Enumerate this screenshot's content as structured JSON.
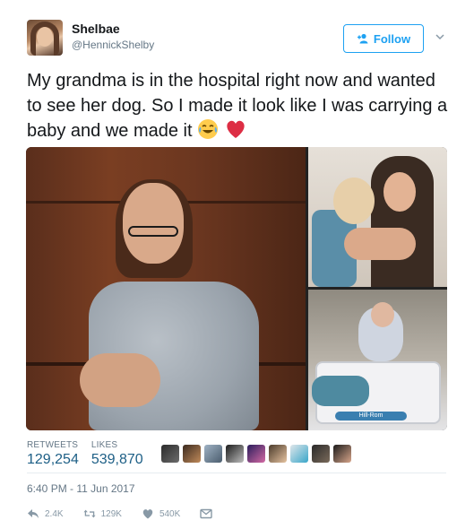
{
  "user": {
    "name": "Shelbae",
    "handle": "@HennickShelby"
  },
  "follow": {
    "label": "Follow"
  },
  "tweet": {
    "text": "My grandma is in the hospital right now and wanted to see her dog. So I made it look like I was carrying a baby and we made it",
    "emojis": [
      "face-with-tears-of-joy",
      "red-heart"
    ]
  },
  "stats": {
    "retweets_label": "RETWEETS",
    "retweets_value": "129,254",
    "likes_label": "LIKES",
    "likes_value": "539,870"
  },
  "timestamp": "6:40 PM - 11 Jun 2017",
  "actions": {
    "reply_count": "2.4K",
    "retweet_count": "129K",
    "like_count": "540K"
  },
  "media": {
    "rail_text": "Hill-Rom"
  },
  "colors": {
    "accent": "#1da1f2",
    "muted": "#657786",
    "text": "#14171a"
  }
}
